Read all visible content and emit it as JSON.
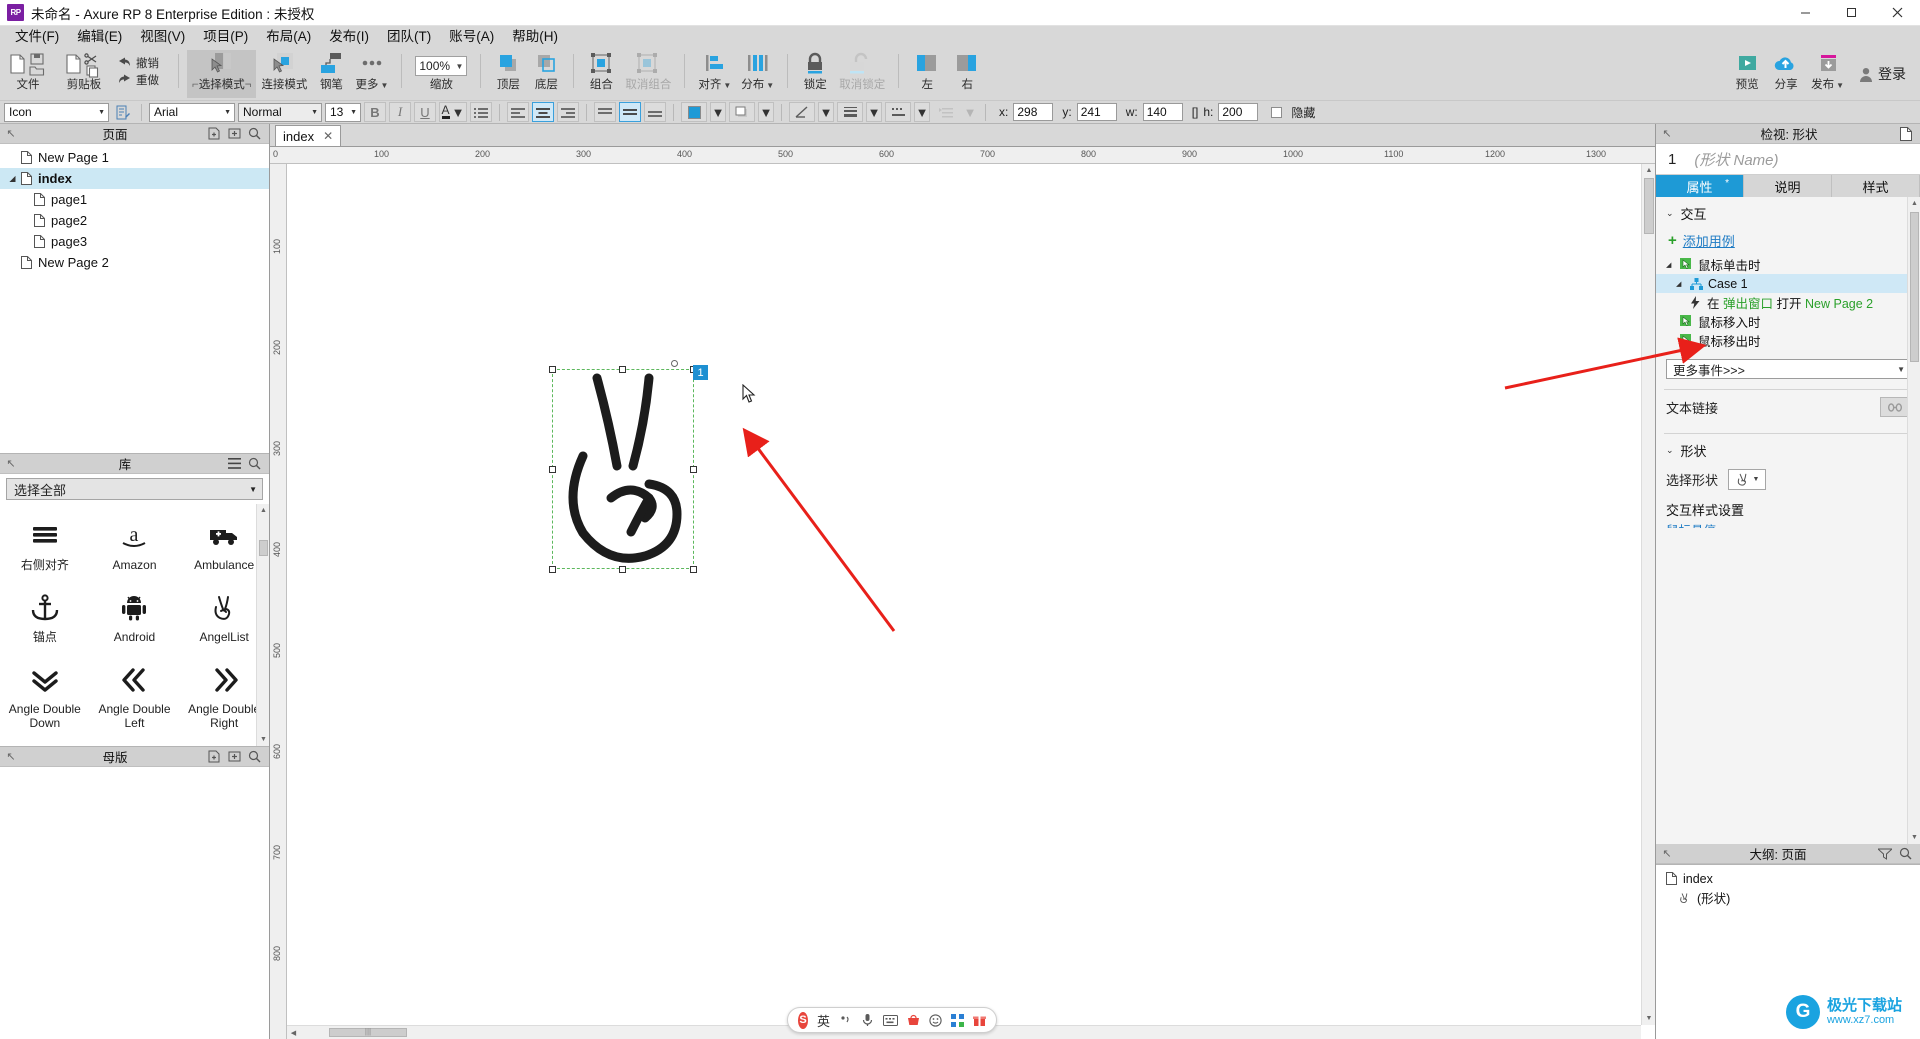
{
  "window": {
    "title": "未命名 - Axure RP 8 Enterprise Edition : 未授权",
    "logo": "RP",
    "minimize": "—",
    "maximize": "▭",
    "close": "✕"
  },
  "menu": [
    {
      "label": "文件(F)"
    },
    {
      "label": "编辑(E)"
    },
    {
      "label": "视图(V)"
    },
    {
      "label": "项目(P)"
    },
    {
      "label": "布局(A)"
    },
    {
      "label": "发布(I)"
    },
    {
      "label": "团队(T)"
    },
    {
      "label": "账号(A)"
    },
    {
      "label": "帮助(H)"
    }
  ],
  "toolbar": {
    "file": "文件",
    "clipboard": "剪贴板",
    "undo": "撤销",
    "redo": "重做",
    "select_mode": "选择模式",
    "connect_mode": "连接模式",
    "pen": "钢笔",
    "more": "更多",
    "zoom_label": "缩放",
    "zoom_value": "100%",
    "top_layer": "顶层",
    "bottom_layer": "底层",
    "group": "组合",
    "ungroup": "取消组合",
    "align": "对齐",
    "distribute": "分布",
    "lock": "锁定",
    "unlock": "取消锁定",
    "left": "左",
    "right": "右",
    "preview": "预览",
    "share": "分享",
    "publish": "发布",
    "login": "登录"
  },
  "propbar": {
    "style_value": "Icon",
    "font_value": "Arial",
    "weight_value": "Normal",
    "size_value": "13",
    "bold": "B",
    "italic": "I",
    "underline": "U",
    "font_color": "A",
    "x_label": "x:",
    "x_value": "298",
    "y_label": "y:",
    "y_value": "241",
    "w_label": "w:",
    "w_value": "140",
    "h_label": "h:",
    "h_value": "200",
    "hidden_label": "隐藏",
    "fill_color": "#1e9ad6"
  },
  "pages_panel": {
    "title": "页面",
    "items": [
      {
        "label": "New Page 1",
        "level": 0,
        "expandable": false,
        "selected": false
      },
      {
        "label": "index",
        "level": 0,
        "expandable": true,
        "selected": true
      },
      {
        "label": "page1",
        "level": 1,
        "expandable": false,
        "selected": false
      },
      {
        "label": "page2",
        "level": 1,
        "expandable": false,
        "selected": false
      },
      {
        "label": "page3",
        "level": 1,
        "expandable": false,
        "selected": false
      },
      {
        "label": "New Page 2",
        "level": 0,
        "expandable": false,
        "selected": false
      }
    ]
  },
  "library_panel": {
    "title": "库",
    "selector_value": "选择全部",
    "items": [
      {
        "label": "右侧对齐",
        "icon": "align-right-icon"
      },
      {
        "label": "Amazon",
        "icon": "amazon-icon"
      },
      {
        "label": "Ambulance",
        "icon": "ambulance-icon"
      },
      {
        "label": "锚点",
        "icon": "anchor-icon"
      },
      {
        "label": "Android",
        "icon": "android-icon"
      },
      {
        "label": "AngelList",
        "icon": "angellist-icon"
      },
      {
        "label": "Angle Double Down",
        "icon": "angle-double-down-icon"
      },
      {
        "label": "Angle Double Left",
        "icon": "angle-double-left-icon"
      },
      {
        "label": "Angle Double Right",
        "icon": "angle-double-right-icon"
      }
    ]
  },
  "masters_panel": {
    "title": "母版"
  },
  "canvas": {
    "tab_label": "index",
    "tab_close": "✕",
    "ruler_h_ticks": [
      "0",
      "100",
      "200",
      "300",
      "400",
      "500",
      "600",
      "700",
      "800",
      "900",
      "1000",
      "1100",
      "1200",
      "1300"
    ],
    "ruler_v_ticks": [
      "100",
      "200",
      "300",
      "400",
      "500",
      "600",
      "700",
      "800"
    ],
    "selection": {
      "badge": "1"
    }
  },
  "inspector": {
    "title": "检视: 形状",
    "widget_number": "1",
    "name_placeholder": "(形状 Name)",
    "tabs": [
      {
        "label": "属性",
        "active": true,
        "marker": "*"
      },
      {
        "label": "说明",
        "active": false,
        "marker": ""
      },
      {
        "label": "样式",
        "active": false,
        "marker": ""
      }
    ],
    "interaction_section": "交互",
    "add_case": "添加用例",
    "events": [
      {
        "label": "鼠标单击时",
        "type": "event",
        "indent": 0,
        "selected": false,
        "expandable": true
      },
      {
        "label": "Case 1",
        "type": "case",
        "indent": 1,
        "selected": true,
        "expandable": true
      },
      {
        "label_prefix": "在",
        "label_mid": "弹出窗口",
        "label_act": "打开",
        "label_target": "New Page 2",
        "type": "action",
        "indent": 2,
        "selected": false,
        "expandable": false
      },
      {
        "label": "鼠标移入时",
        "type": "event",
        "indent": 0,
        "selected": false,
        "expandable": false
      },
      {
        "label": "鼠标移出时",
        "type": "event",
        "indent": 0,
        "selected": false,
        "expandable": false
      }
    ],
    "more_events": "更多事件>>>",
    "text_link": "文本链接",
    "shape_section": "形状",
    "select_shape_label": "选择形状",
    "interaction_style_label": "交互样式设置",
    "mouse_hover_partial": "鼠标悬停"
  },
  "outline_panel": {
    "title": "大纲: 页面",
    "items": [
      {
        "label": "index",
        "indent": 0,
        "icon": "page-icon"
      },
      {
        "label": "(形状)",
        "indent": 1,
        "icon": "shape-icon"
      }
    ]
  },
  "ime": {
    "logo": "S",
    "lang": "英",
    "icons": [
      "comma-icon",
      "mic-icon",
      "keyboard-icon",
      "shopping-icon",
      "smiley-icon",
      "apps-icon",
      "gift-icon"
    ]
  },
  "watermark": {
    "mark": "G",
    "line1": "极光下载站",
    "line2": "www.xz7.com"
  },
  "colors": {
    "accent": "#1e9ad6",
    "selection_green": "#5cb85c",
    "arrow_red": "#e8201a",
    "link_blue": "#1e7bc4",
    "event_green": "#2aa02a"
  }
}
